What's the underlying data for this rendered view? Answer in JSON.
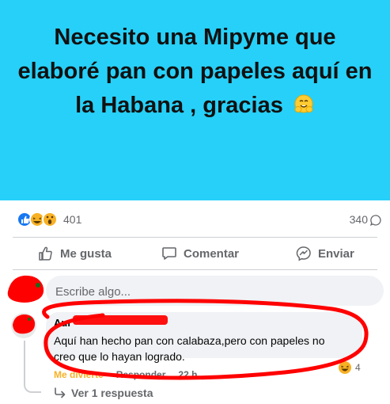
{
  "post": {
    "text": "Necesito una Mipyme que elaboré pan con papeles aquí en la Habana , gracias",
    "emoji": "hugging-face-icon",
    "background": "#27d0f8"
  },
  "stats": {
    "reactions_count": "401",
    "reaction_icons": [
      "like-icon",
      "haha-icon",
      "wow-icon"
    ],
    "comments_count": "340"
  },
  "actions": {
    "like_label": "Me gusta",
    "comment_label": "Comentar",
    "share_label": "Enviar"
  },
  "composer": {
    "placeholder": "Escribe algo...",
    "tools": [
      "sticker-icon",
      "emoji-icon",
      "camera-icon",
      "gif-icon",
      "stickers-pack-icon"
    ]
  },
  "comment": {
    "author": "Aur",
    "text": "Aquí han hecho pan con calabaza,pero con papeles no creo que lo hayan logrado.",
    "reaction_label": "Me divierte",
    "reply_label": "Responder",
    "time": "22 h",
    "reaction_count": "4",
    "replies_label": "Ver 1 respuesta"
  },
  "colors": {
    "secondary_text": "#65676b",
    "bubble": "#f0f2f5",
    "scribble": "#ff0000",
    "laugh": "#f7b125"
  }
}
